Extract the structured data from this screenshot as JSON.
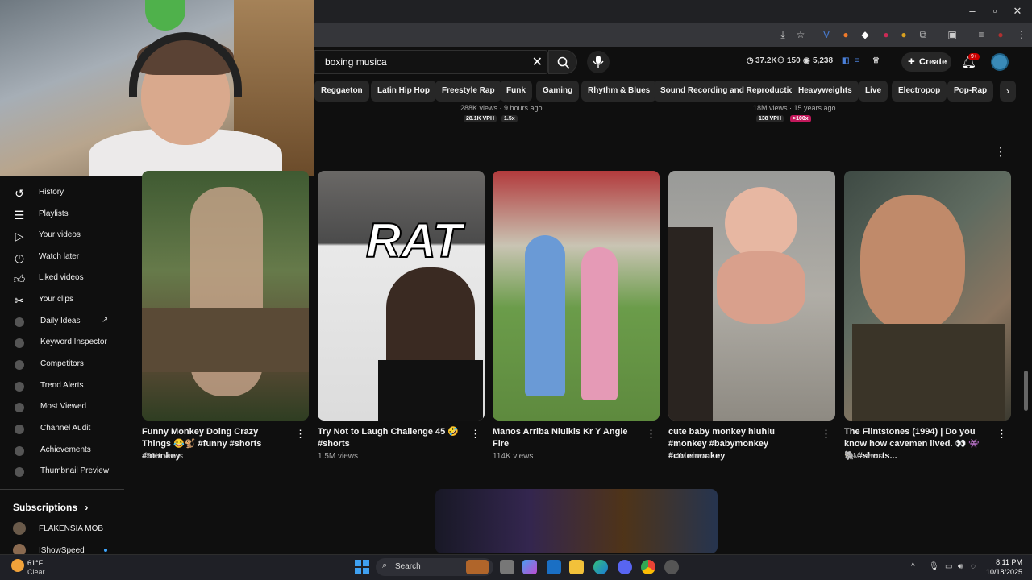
{
  "search": {
    "query": "boxing musica"
  },
  "header": {
    "stats": [
      "37.2K",
      "150",
      "5,238"
    ],
    "create_label": "Create",
    "notif_count": "9+"
  },
  "chips": [
    "Reggaeton",
    "Latin Hip Hop",
    "Freestyle Rap",
    "Funk",
    "Gaming",
    "Rhythm & Blues",
    "Sound Recording and Reproduction",
    "Heavyweights",
    "Live",
    "Electropop",
    "Pop-Rap"
  ],
  "prev_row": [
    {
      "meta": "288K views · 9 hours ago",
      "vph": "28.1K VPH",
      "mult": "1.5x"
    },
    {
      "meta": "18M views · 15 years ago",
      "vph": "138 VPH",
      "mult": ">100x"
    }
  ],
  "sidebar": {
    "items": [
      {
        "label": "History",
        "icon": "history-icon"
      },
      {
        "label": "Playlists",
        "icon": "playlists-icon"
      },
      {
        "label": "Your videos",
        "icon": "your-videos-icon"
      },
      {
        "label": "Watch later",
        "icon": "watch-later-icon"
      },
      {
        "label": "Liked videos",
        "icon": "thumbs-up-icon"
      },
      {
        "label": "Your clips",
        "icon": "scissors-icon"
      },
      {
        "label": "Daily Ideas",
        "icon": "ext-icon"
      },
      {
        "label": "Keyword Inspector",
        "icon": "ext-icon"
      },
      {
        "label": "Competitors",
        "icon": "ext-icon"
      },
      {
        "label": "Trend Alerts",
        "icon": "ext-icon"
      },
      {
        "label": "Most Viewed",
        "icon": "ext-icon"
      },
      {
        "label": "Channel Audit",
        "icon": "ext-icon"
      },
      {
        "label": "Achievements",
        "icon": "ext-icon"
      },
      {
        "label": "Thumbnail Preview",
        "icon": "ext-icon"
      }
    ],
    "subscriptions_label": "Subscriptions",
    "subscriptions": [
      "FLAKENSIA MOB",
      "IShowSpeed"
    ]
  },
  "shorts": [
    {
      "title": "Funny Monkey Doing Crazy Things 😂🐒 #funny #shorts #monkey",
      "views": "459K views"
    },
    {
      "title": "Try Not to Laugh Challenge 45 🤣 #shorts",
      "views": "1.5M views",
      "overlay": "RAT"
    },
    {
      "title": "Manos Arriba Niulkis Kr Y Angie Fire",
      "views": "114K views"
    },
    {
      "title": "cute baby monkey hiuhiu #monkey #babymonkey #cutemonkey",
      "views": "5.4M views"
    },
    {
      "title": "The Flintstones (1994) | Do you know how cavemen lived. 👀 👾🐘 #shorts...",
      "views": "13M views"
    }
  ],
  "taskbar": {
    "temp": "61°F",
    "condition": "Clear",
    "search_label": "Search",
    "time": "8:11 PM",
    "date": "10/18/2025"
  },
  "colors": {
    "accent": "#cc0000",
    "background": "#0f0f0f",
    "chip": "#272727"
  }
}
